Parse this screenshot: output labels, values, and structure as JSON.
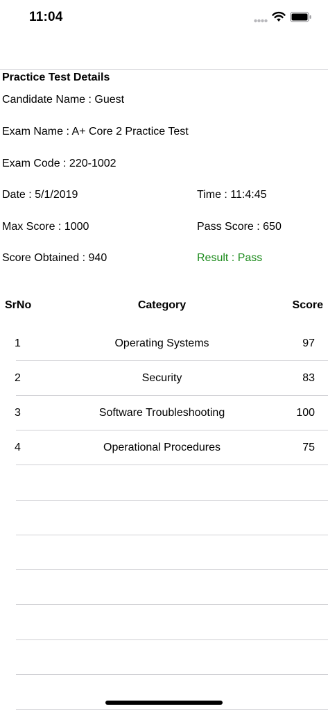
{
  "status_bar": {
    "time": "11:04"
  },
  "details": {
    "title": "Practice Test Details",
    "candidate": "Candidate Name : Guest",
    "exam_name": "Exam Name : A+ Core 2 Practice Test",
    "exam_code": "Exam Code : 220-1002",
    "date": "Date : 5/1/2019",
    "time": "Time : 11:4:45",
    "max_score": "Max Score : 1000",
    "pass_score": "Pass Score : 650",
    "score_obtained": "Score Obtained : 940",
    "result": "Result : Pass",
    "result_color": "#1a8a1a"
  },
  "table": {
    "headers": {
      "srno": "SrNo",
      "category": "Category",
      "score": "Score"
    },
    "rows": [
      {
        "srno": "1",
        "category": "Operating Systems",
        "score": "97"
      },
      {
        "srno": "2",
        "category": "Security",
        "score": "83"
      },
      {
        "srno": "3",
        "category": "Software Troubleshooting",
        "score": "100"
      },
      {
        "srno": "4",
        "category": "Operational Procedures",
        "score": "75"
      }
    ]
  }
}
